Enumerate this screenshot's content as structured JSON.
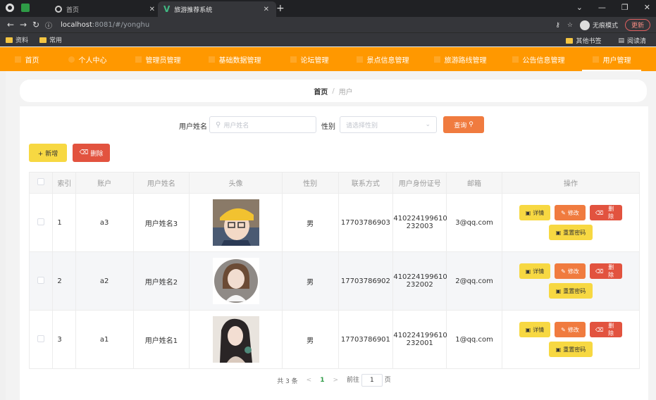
{
  "browser": {
    "tabs": [
      {
        "title": "首页"
      },
      {
        "title": "旅游推荐系统"
      }
    ],
    "url_host": "localhost",
    "url_rest": ":8081/#/yonghu",
    "incognito_label": "无痕模式",
    "update_label": "更新",
    "bookmarks": [
      "资料",
      "常用"
    ],
    "bookmarks_right": [
      "其他书签",
      "阅读清"
    ]
  },
  "topnav": {
    "items": [
      {
        "label": "首页"
      },
      {
        "label": "个人中心"
      },
      {
        "label": "管理员管理"
      },
      {
        "label": "基础数据管理"
      },
      {
        "label": "论坛管理"
      },
      {
        "label": "景点信息管理"
      },
      {
        "label": "旅游路线管理"
      },
      {
        "label": "公告信息管理"
      },
      {
        "label": "用户管理"
      }
    ]
  },
  "breadcrumb": {
    "home": "首页",
    "sep": "/",
    "current": "用户"
  },
  "search": {
    "name_label": "用户姓名",
    "name_placeholder": "用户姓名",
    "gender_label": "性别",
    "gender_placeholder": "请选择性别",
    "query_label": "查询"
  },
  "actions": {
    "add_label": "+ 新增",
    "delete_label": "删除"
  },
  "table": {
    "headers": [
      "",
      "索引",
      "账户",
      "用户姓名",
      "头像",
      "性别",
      "联系方式",
      "用户身份证号",
      "邮箱",
      "操作"
    ],
    "op_labels": {
      "detail": "详情",
      "edit": "修改",
      "remove": "删除",
      "reset": "重置密码"
    },
    "rows": [
      {
        "index": "1",
        "account": "a3",
        "name": "用户姓名3",
        "gender": "男",
        "phone": "17703786903",
        "id_line1": "410224199610",
        "id_line2": "232003",
        "email": "3@qq.com"
      },
      {
        "index": "2",
        "account": "a2",
        "name": "用户姓名2",
        "gender": "男",
        "phone": "17703786902",
        "id_line1": "410224199610",
        "id_line2": "232002",
        "email": "2@qq.com"
      },
      {
        "index": "3",
        "account": "a1",
        "name": "用户姓名1",
        "gender": "男",
        "phone": "17703786901",
        "id_line1": "410224199610",
        "id_line2": "232001",
        "email": "1@qq.com"
      }
    ]
  },
  "pager": {
    "total": "共 3 条",
    "prev": "<",
    "page": "1",
    "next": ">",
    "goto": "前往",
    "goto_value": "1",
    "unit": "页"
  },
  "colors": {
    "accent": "#ff9800",
    "yellow": "#f7d842",
    "orange": "#f07b3f",
    "red": "#e2533f"
  }
}
